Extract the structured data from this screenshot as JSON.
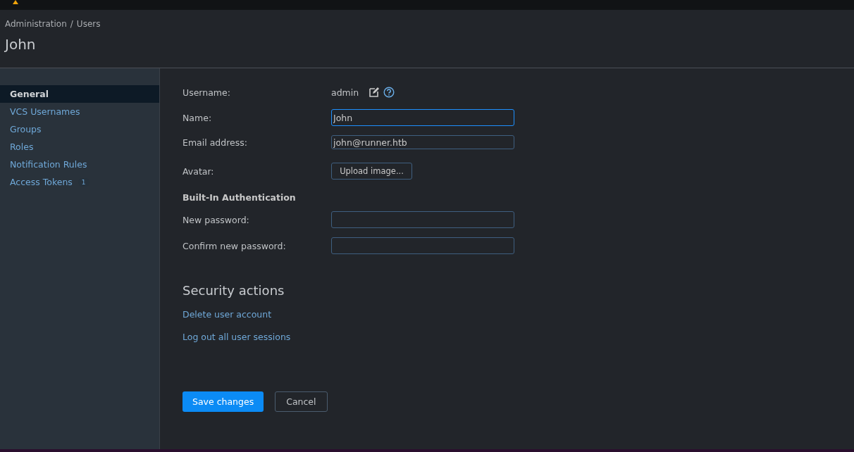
{
  "breadcrumbs": [
    "Administration",
    "Users"
  ],
  "breadcrumb_separator": "/",
  "title": "John",
  "sidebar": {
    "items": [
      {
        "label": "General",
        "selected": true
      },
      {
        "label": "VCS Usernames",
        "selected": false
      },
      {
        "label": "Groups",
        "selected": false
      },
      {
        "label": "Roles",
        "selected": false
      },
      {
        "label": "Notification Rules",
        "selected": false
      },
      {
        "label": "Access Tokens",
        "selected": false,
        "badge": "1"
      }
    ]
  },
  "form": {
    "username_label": "Username:",
    "username": "admin",
    "name_label": "Name:",
    "name_value": "John",
    "email_label": "Email address:",
    "email_value": "john@runner.htb",
    "avatar_label": "Avatar:",
    "upload_button": "Upload image...",
    "auth_heading": "Built-In Authentication",
    "new_password_label": "New password:",
    "confirm_password_label": "Confirm new password:"
  },
  "security": {
    "heading": "Security actions",
    "links": [
      "Delete user account",
      "Log out all user sessions"
    ]
  },
  "buttons": {
    "save": "Save changes",
    "cancel": "Cancel"
  }
}
